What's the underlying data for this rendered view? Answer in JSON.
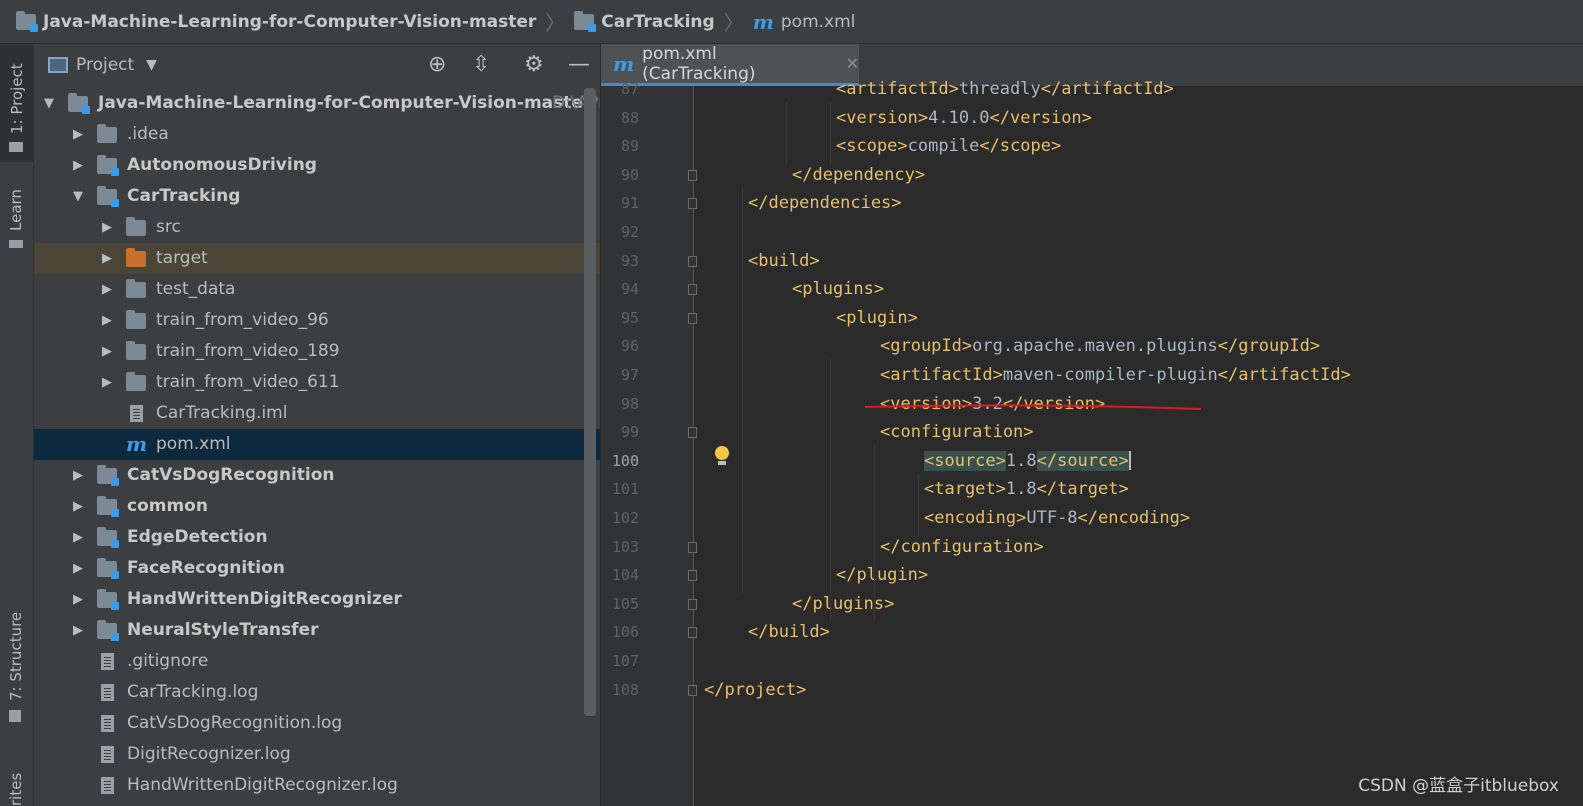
{
  "breadcrumb": {
    "project": "Java-Machine-Learning-for-Computer-Vision-master",
    "module": "CarTracking",
    "file": "pom.xml",
    "file_icon": "m"
  },
  "toolstrip": {
    "project_tab": "1: Project",
    "learn_tab": "Learn",
    "structure_tab": "7: Structure",
    "favorites_tab": "rites"
  },
  "project_panel": {
    "title": "Project",
    "tree": [
      {
        "label": "Java-Machine-Learning-for-Computer-Vision-master",
        "path": "D:\\APr",
        "depth": 0,
        "expanded": true,
        "type": "module"
      },
      {
        "label": ".idea",
        "depth": 1,
        "expanded": false,
        "type": "folder"
      },
      {
        "label": "AutonomousDriving",
        "depth": 1,
        "expanded": false,
        "type": "module"
      },
      {
        "label": "CarTracking",
        "depth": 1,
        "expanded": true,
        "type": "module"
      },
      {
        "label": "src",
        "depth": 2,
        "expanded": false,
        "type": "folder"
      },
      {
        "label": "target",
        "depth": 2,
        "expanded": false,
        "type": "excluded"
      },
      {
        "label": "test_data",
        "depth": 2,
        "expanded": false,
        "type": "folder"
      },
      {
        "label": "train_from_video_96",
        "depth": 2,
        "expanded": false,
        "type": "folder"
      },
      {
        "label": "train_from_video_189",
        "depth": 2,
        "expanded": false,
        "type": "folder"
      },
      {
        "label": "train_from_video_611",
        "depth": 2,
        "expanded": false,
        "type": "folder"
      },
      {
        "label": "CarTracking.iml",
        "depth": 2,
        "type": "file"
      },
      {
        "label": "pom.xml",
        "depth": 2,
        "type": "maven",
        "selected": true
      },
      {
        "label": "CatVsDogRecognition",
        "depth": 1,
        "expanded": false,
        "type": "module"
      },
      {
        "label": "common",
        "depth": 1,
        "expanded": false,
        "type": "module"
      },
      {
        "label": "EdgeDetection",
        "depth": 1,
        "expanded": false,
        "type": "module"
      },
      {
        "label": "FaceRecognition",
        "depth": 1,
        "expanded": false,
        "type": "module"
      },
      {
        "label": "HandWrittenDigitRecognizer",
        "depth": 1,
        "expanded": false,
        "type": "module"
      },
      {
        "label": "NeuralStyleTransfer",
        "depth": 1,
        "expanded": false,
        "type": "module"
      },
      {
        "label": ".gitignore",
        "depth": 1,
        "type": "file"
      },
      {
        "label": "CarTracking.log",
        "depth": 1,
        "type": "file"
      },
      {
        "label": "CatVsDogRecognition.log",
        "depth": 1,
        "type": "file"
      },
      {
        "label": "DigitRecognizer.log",
        "depth": 1,
        "type": "file"
      },
      {
        "label": "HandWrittenDigitRecognizer.log",
        "depth": 1,
        "type": "file"
      }
    ]
  },
  "editor": {
    "tab_label": "pom.xml (CarTracking)",
    "current_line": "100",
    "lines": [
      {
        "n": "87",
        "indent": 3,
        "tag": "artifactId",
        "text": "threadly"
      },
      {
        "n": "88",
        "indent": 3,
        "tag": "version",
        "text": "4.10.0"
      },
      {
        "n": "89",
        "indent": 3,
        "tag": "scope",
        "text": "compile"
      },
      {
        "n": "90",
        "indent": 2,
        "close": "dependency"
      },
      {
        "n": "91",
        "indent": 1,
        "close": "dependencies"
      },
      {
        "n": "92"
      },
      {
        "n": "93",
        "indent": 1,
        "open": "build"
      },
      {
        "n": "94",
        "indent": 2,
        "open": "plugins"
      },
      {
        "n": "95",
        "indent": 3,
        "open": "plugin"
      },
      {
        "n": "96",
        "indent": 4,
        "tag": "groupId",
        "text": "org.apache.maven.plugins"
      },
      {
        "n": "97",
        "indent": 4,
        "tag": "artifactId",
        "text": "maven-compiler-plugin"
      },
      {
        "n": "98",
        "indent": 4,
        "tag": "version",
        "text": "3.2"
      },
      {
        "n": "99",
        "indent": 4,
        "open": "configuration"
      },
      {
        "n": "100",
        "indent": 5,
        "tag": "source",
        "text": "1.8"
      },
      {
        "n": "101",
        "indent": 5,
        "tag": "target",
        "text": "1.8"
      },
      {
        "n": "102",
        "indent": 5,
        "tag": "encoding",
        "text": "UTF-8"
      },
      {
        "n": "103",
        "indent": 4,
        "close": "configuration"
      },
      {
        "n": "104",
        "indent": 3,
        "close": "plugin"
      },
      {
        "n": "105",
        "indent": 2,
        "close": "plugins"
      },
      {
        "n": "106",
        "indent": 1,
        "close": "build"
      },
      {
        "n": "107"
      },
      {
        "n": "108",
        "indent": 0,
        "close": "project"
      }
    ]
  },
  "colors": {
    "tag": "#e8bf6a",
    "text": "#a9b7c6",
    "selection": "#0d293e",
    "accent": "#4a88c7",
    "annotation_underline": "#e01b1b"
  },
  "watermark": "CSDN @蓝盒子itbluebox"
}
